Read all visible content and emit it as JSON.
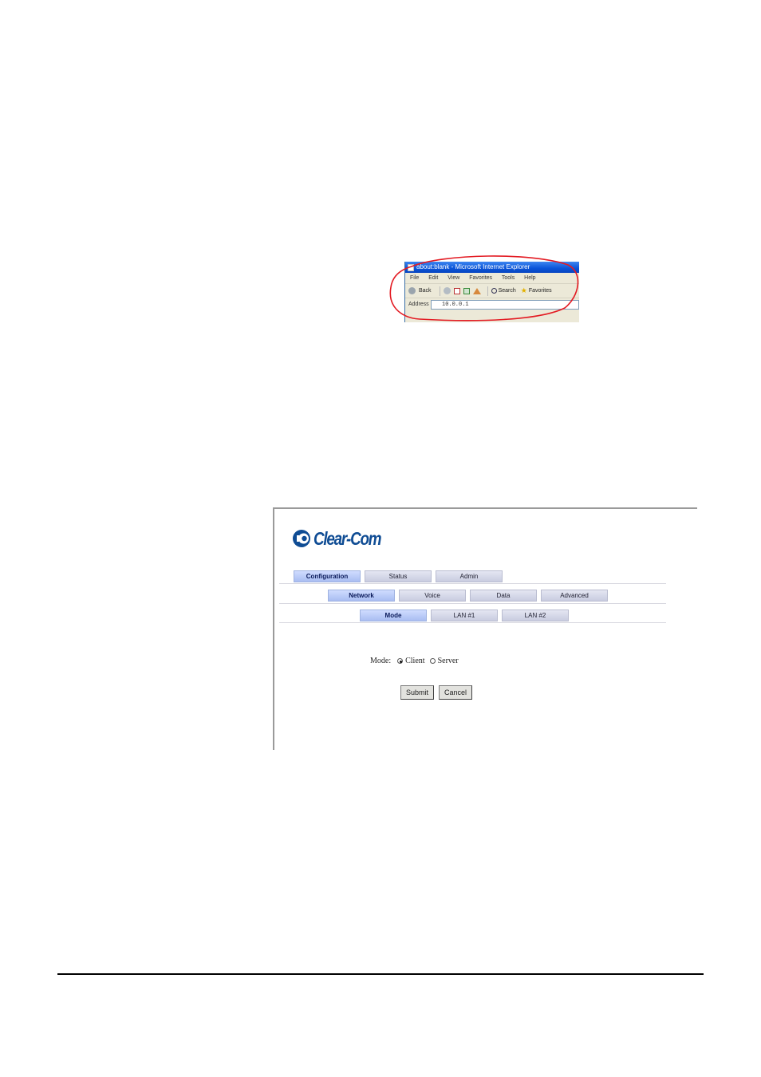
{
  "ie_screenshot": {
    "title": "about:blank - Microsoft Internet Explorer",
    "menu": [
      "File",
      "Edit",
      "View",
      "Favorites",
      "Tools",
      "Help"
    ],
    "toolbar": {
      "back": "Back",
      "search": "Search",
      "favorites": "Favorites"
    },
    "address_label": "Address",
    "address_value": "10.0.0.1",
    "highlight_color": "#e31b23"
  },
  "clearcom": {
    "logo_text": "Clear-Com",
    "brand_color": "#0f4c94",
    "tabs_row1": [
      {
        "label": "Configuration",
        "active": true
      },
      {
        "label": "Status",
        "active": false
      },
      {
        "label": "Admin",
        "active": false
      }
    ],
    "tabs_row2": [
      {
        "label": "Network",
        "active": true
      },
      {
        "label": "Voice",
        "active": false
      },
      {
        "label": "Data",
        "active": false
      },
      {
        "label": "Advanced",
        "active": false
      }
    ],
    "tabs_row3": [
      {
        "label": "Mode",
        "active": true
      },
      {
        "label": "LAN #1",
        "active": false
      },
      {
        "label": "LAN #2",
        "active": false
      }
    ],
    "mode_label": "Mode:",
    "mode_options": [
      {
        "label": "Client",
        "checked": true
      },
      {
        "label": "Server",
        "checked": false
      }
    ],
    "submit_label": "Submit",
    "cancel_label": "Cancel"
  }
}
